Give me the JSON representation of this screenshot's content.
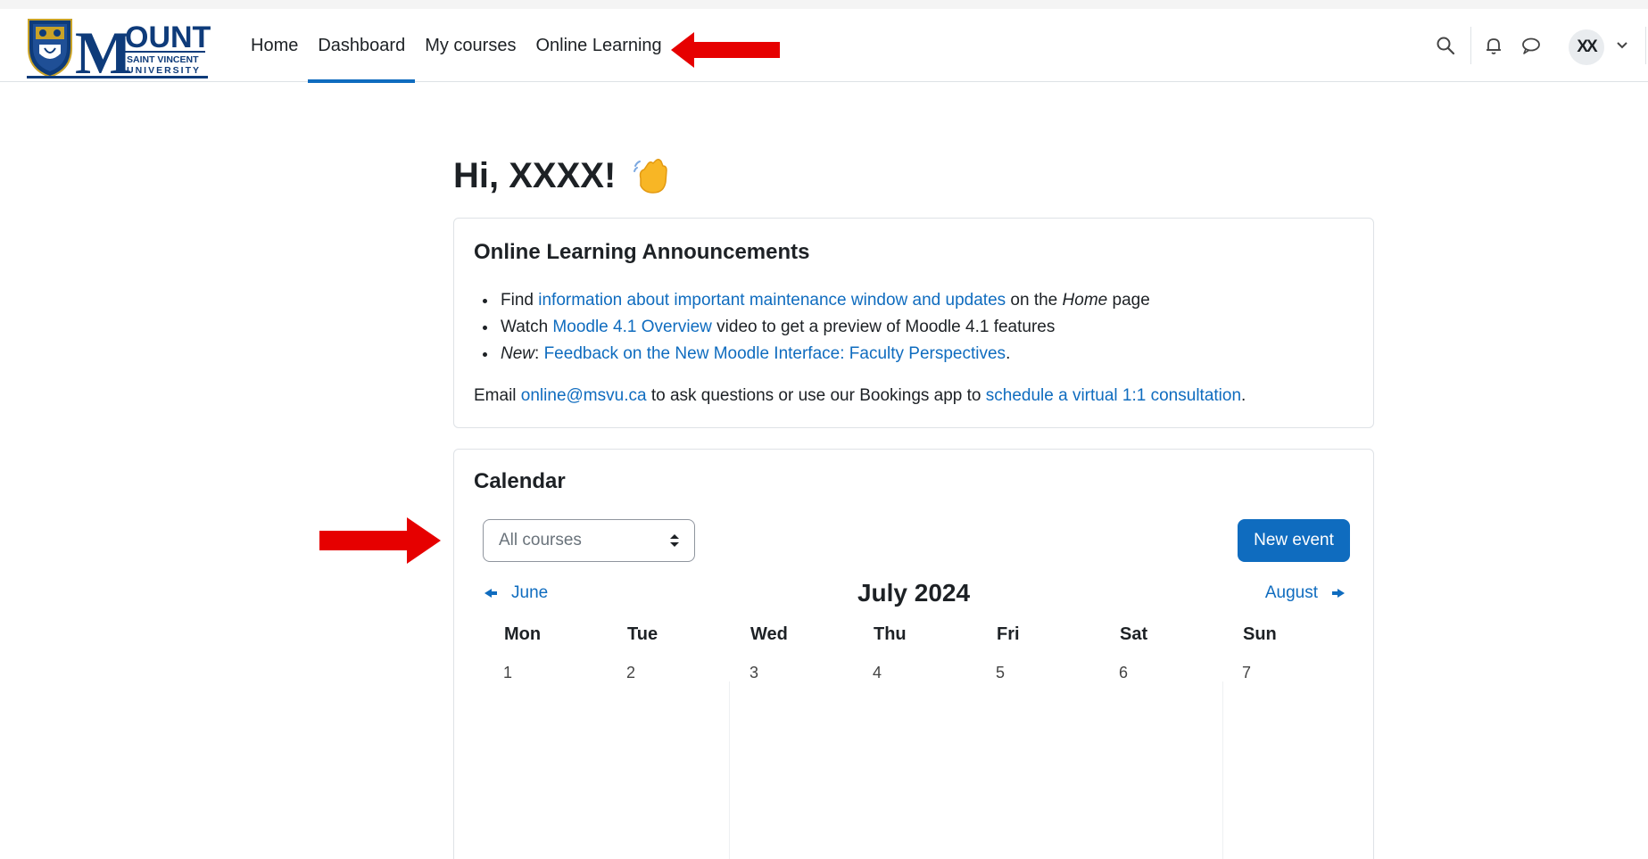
{
  "logo": {
    "word": "OUNT",
    "initial": "M",
    "line1": "SAINT VINCENT",
    "line2": "UNIVERSITY"
  },
  "nav": {
    "items": [
      {
        "label": "Home",
        "active": false
      },
      {
        "label": "Dashboard",
        "active": true
      },
      {
        "label": "My courses",
        "active": false
      },
      {
        "label": "Online Learning",
        "active": false
      }
    ],
    "user_initials": "XX"
  },
  "greeting": {
    "text": "Hi, XXXX!",
    "emoji": "👋"
  },
  "announcements": {
    "title": "Online Learning Announcements",
    "items": [
      {
        "pre": "Find ",
        "link": "information about important maintenance window and updates",
        "post": " on the ",
        "em": "Home",
        "post2": " page"
      },
      {
        "pre": "Watch ",
        "link": "Moodle 4.1 Overview",
        "post": " video to get a preview of Moodle 4.1 features"
      },
      {
        "em": "New",
        "pre": ": ",
        "link": "Feedback on the New Moodle Interface: Faculty Perspectives",
        "post": "."
      }
    ],
    "email_pre": "Email ",
    "email_link": "online@msvu.ca",
    "email_mid": " to ask questions or use our Bookings app to ",
    "email_link2": "schedule a virtual 1:1 consultation",
    "email_post": "."
  },
  "calendar": {
    "title": "Calendar",
    "course_filter": "All courses",
    "new_event": "New event",
    "prev_month": "June",
    "current_month": "July 2024",
    "next_month": "August",
    "weekdays": [
      "Mon",
      "Tue",
      "Wed",
      "Thu",
      "Fri",
      "Sat",
      "Sun"
    ],
    "days": [
      "1",
      "2",
      "3",
      "4",
      "5",
      "6",
      "7"
    ]
  },
  "colors": {
    "accent": "#0f6cbf",
    "arrow": "#e60000",
    "text": "#1d2125"
  }
}
